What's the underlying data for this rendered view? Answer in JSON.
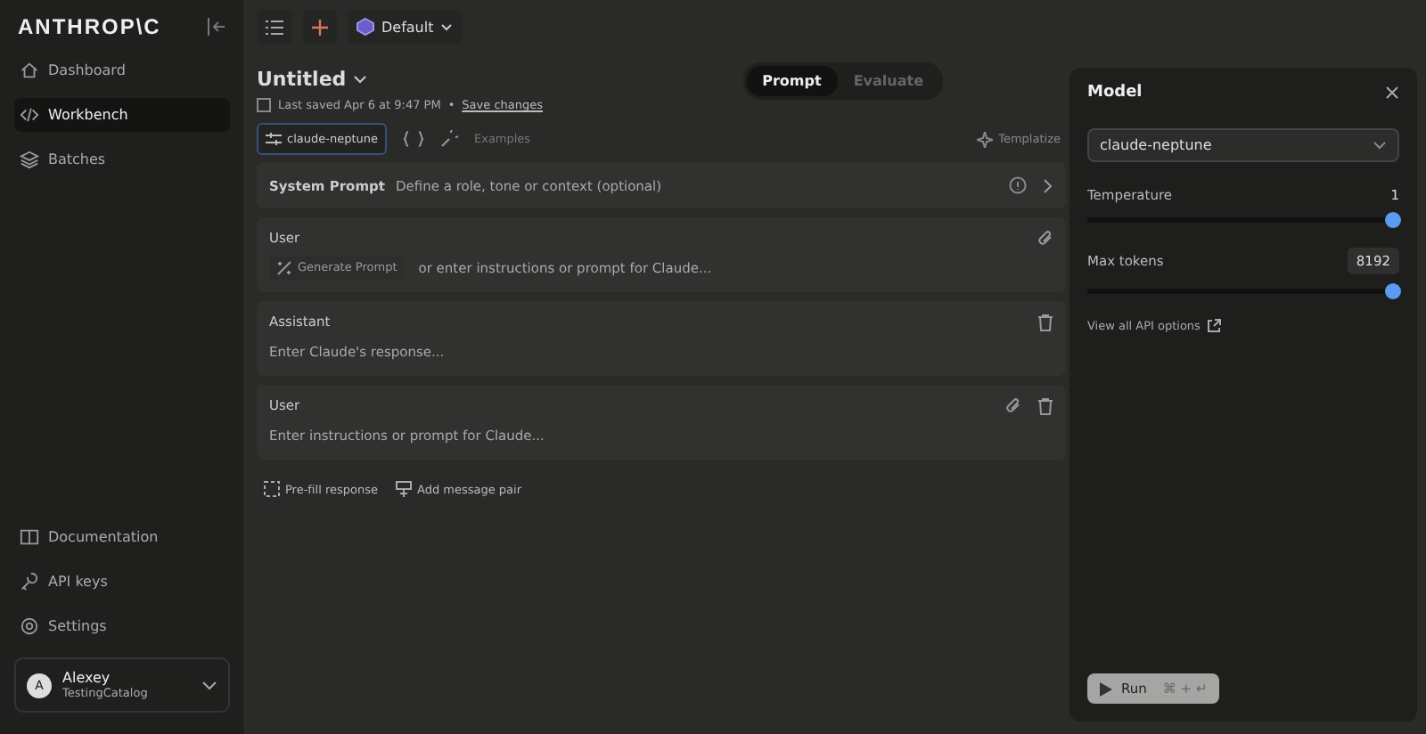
{
  "sidebar": {
    "logo": "ANTHROP\\C",
    "items": [
      {
        "label": "Dashboard",
        "selected": false
      },
      {
        "label": "Workbench",
        "selected": true
      },
      {
        "label": "Batches",
        "selected": false
      }
    ],
    "bottom_items": [
      "Documentation",
      "API keys",
      "Settings"
    ],
    "user": {
      "initial": "A",
      "name": "Alexey",
      "org": "TestingCatalog"
    }
  },
  "toolbar": {
    "workspace": "Default"
  },
  "prompt": {
    "title": "Untitled",
    "saved": "Last saved Apr 6 at 9:47 PM",
    "separator": "•",
    "save_link": "Save changes"
  },
  "mode_tabs": [
    {
      "label": "Prompt",
      "selected": true
    },
    {
      "label": "Evaluate",
      "selected": false
    }
  ],
  "model_chip": "claude-neptune",
  "examples": "Examples",
  "templatize": "Templatize",
  "messages": [
    {
      "kind": "system",
      "label": "System Prompt",
      "placeholder": "Define a role, tone or context (optional)"
    },
    {
      "kind": "user_first",
      "label": "User",
      "button": "Generate Prompt",
      "placeholder": "or enter instructions or prompt for Claude..."
    },
    {
      "kind": "assistant",
      "label": "Assistant",
      "placeholder": "Enter Claude's response..."
    },
    {
      "kind": "user",
      "label": "User",
      "placeholder": "Enter instructions or prompt for Claude..."
    }
  ],
  "actions": [
    "Pre-fill response",
    "Add message pair"
  ],
  "model_panel": {
    "title": "Model",
    "model": "claude-neptune",
    "settings": [
      {
        "kind": "plain",
        "label": "Temperature",
        "value": "1",
        "level": 1
      },
      {
        "kind": "field",
        "label": "Max tokens",
        "value": "8192",
        "level": 1
      }
    ],
    "api_link": "View all API options",
    "run": {
      "label": "Run",
      "shortcut": "⌘ + ↵",
      "disabled": true
    }
  }
}
